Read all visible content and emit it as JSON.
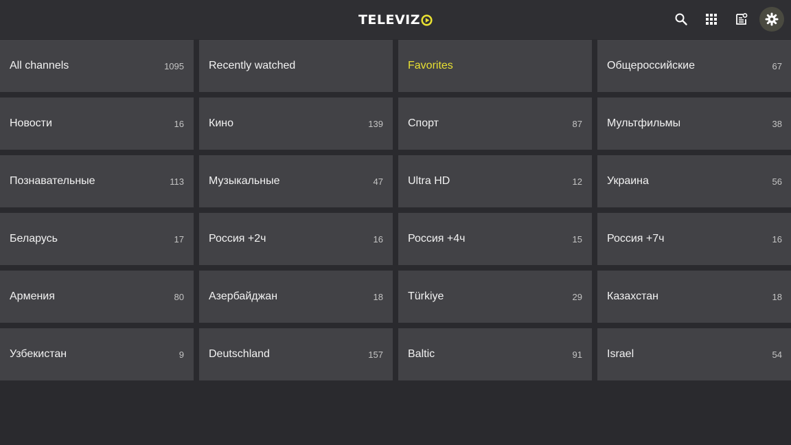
{
  "app": {
    "logo_text": "TELEVIZ",
    "colors": {
      "background": "#2a2a2e",
      "topbar": "#2f2f33",
      "tile": "#424246",
      "accent": "#e8e032"
    }
  },
  "toolbar": {
    "icons": [
      "search-icon",
      "apps-grid-icon",
      "playlist-icon",
      "settings-icon"
    ],
    "active": "settings-icon"
  },
  "categories": [
    {
      "name": "All channels",
      "count": "1095"
    },
    {
      "name": "Recently watched",
      "count": ""
    },
    {
      "name": "Favorites",
      "count": "",
      "selected": true
    },
    {
      "name": "Общероссийские",
      "count": "67"
    },
    {
      "name": "Новости",
      "count": "16"
    },
    {
      "name": "Кино",
      "count": "139"
    },
    {
      "name": "Спорт",
      "count": "87"
    },
    {
      "name": "Мультфильмы",
      "count": "38"
    },
    {
      "name": "Познавательные",
      "count": "113"
    },
    {
      "name": "Музыкальные",
      "count": "47"
    },
    {
      "name": "Ultra HD",
      "count": "12"
    },
    {
      "name": "Украина",
      "count": "56"
    },
    {
      "name": "Беларусь",
      "count": "17"
    },
    {
      "name": "Россия +2ч",
      "count": "16"
    },
    {
      "name": "Россия +4ч",
      "count": "15"
    },
    {
      "name": "Россия +7ч",
      "count": "16"
    },
    {
      "name": "Армения",
      "count": "80"
    },
    {
      "name": "Азербайджан",
      "count": "18"
    },
    {
      "name": "Türkiye",
      "count": "29"
    },
    {
      "name": "Казахстан",
      "count": "18"
    },
    {
      "name": "Узбекистан",
      "count": "9"
    },
    {
      "name": "Deutschland",
      "count": "157"
    },
    {
      "name": "Baltic",
      "count": "91"
    },
    {
      "name": "Israel",
      "count": "54"
    }
  ]
}
